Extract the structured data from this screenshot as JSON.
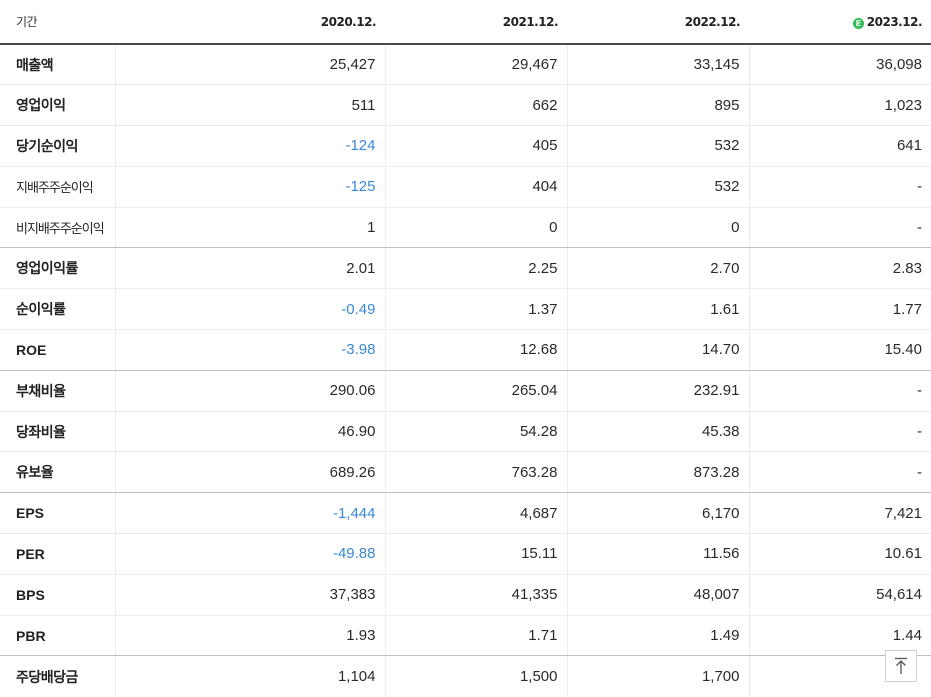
{
  "table": {
    "header": {
      "label": "기간",
      "periods": [
        {
          "label": "2020.12.",
          "estimate": false
        },
        {
          "label": "2021.12.",
          "estimate": false
        },
        {
          "label": "2022.12.",
          "estimate": false
        },
        {
          "label": "2023.12.",
          "estimate": true,
          "estimate_mark": "E"
        }
      ]
    },
    "rows": [
      {
        "label": "매출액",
        "values": [
          "25,427",
          "29,467",
          "33,145",
          "36,098"
        ]
      },
      {
        "label": "영업이익",
        "values": [
          "511",
          "662",
          "895",
          "1,023"
        ]
      },
      {
        "label": "당기순이익",
        "values": [
          "-124",
          "405",
          "532",
          "641"
        ]
      },
      {
        "label": "지배주주순이익",
        "values": [
          "-125",
          "404",
          "532",
          "-"
        ]
      },
      {
        "label": "비지배주주순이익",
        "values": [
          "1",
          "0",
          "0",
          "-"
        ]
      },
      {
        "label": "영업이익률",
        "values": [
          "2.01",
          "2.25",
          "2.70",
          "2.83"
        ]
      },
      {
        "label": "순이익률",
        "values": [
          "-0.49",
          "1.37",
          "1.61",
          "1.77"
        ]
      },
      {
        "label": "ROE",
        "values": [
          "-3.98",
          "12.68",
          "14.70",
          "15.40"
        ]
      },
      {
        "label": "부채비율",
        "values": [
          "290.06",
          "265.04",
          "232.91",
          "-"
        ]
      },
      {
        "label": "당좌비율",
        "values": [
          "46.90",
          "54.28",
          "45.38",
          "-"
        ]
      },
      {
        "label": "유보율",
        "values": [
          "689.26",
          "763.28",
          "873.28",
          "-"
        ]
      },
      {
        "label": "EPS",
        "values": [
          "-1,444",
          "4,687",
          "6,170",
          "7,421"
        ]
      },
      {
        "label": "PER",
        "values": [
          "-49.88",
          "15.11",
          "11.56",
          "10.61"
        ]
      },
      {
        "label": "BPS",
        "values": [
          "37,383",
          "41,335",
          "48,007",
          "54,614"
        ]
      },
      {
        "label": "PBR",
        "values": [
          "1.93",
          "1.71",
          "1.49",
          "1.44"
        ]
      },
      {
        "label": "주당배당금",
        "values": [
          "1,104",
          "1,500",
          "1,700",
          ""
        ]
      }
    ]
  },
  "colors": {
    "negative": "#3a87d6",
    "estimate_badge": "#2fbf57",
    "header_rule": "#4a4a4a",
    "group_rule": "#bdbdbd",
    "cell_rule": "#ececec"
  },
  "scroll_top_button": {
    "icon": "arrow-up-to-line-icon"
  }
}
